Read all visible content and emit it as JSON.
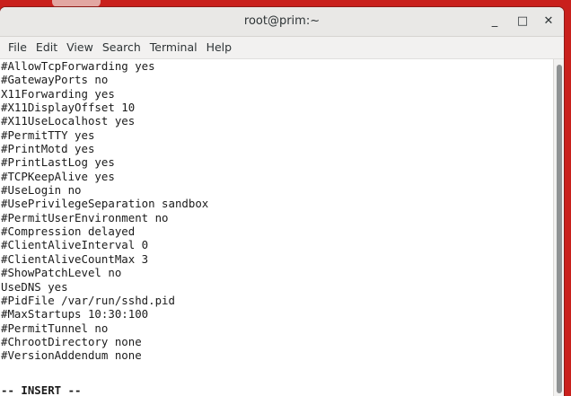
{
  "window": {
    "title": "root@prim:~",
    "minimize_glyph": "_",
    "maximize_glyph": "□",
    "close_glyph": "✕"
  },
  "menu": [
    "File",
    "Edit",
    "View",
    "Search",
    "Terminal",
    "Help"
  ],
  "terminal": {
    "lines": [
      "#AllowTcpForwarding yes",
      "#GatewayPorts no",
      "X11Forwarding yes",
      "#X11DisplayOffset 10",
      "#X11UseLocalhost yes",
      "#PermitTTY yes",
      "#PrintMotd yes",
      "#PrintLastLog yes",
      "#TCPKeepAlive yes",
      "#UseLogin no",
      "#UsePrivilegeSeparation sandbox",
      "#PermitUserEnvironment no",
      "#Compression delayed",
      "#ClientAliveInterval 0",
      "#ClientAliveCountMax 3",
      "#ShowPatchLevel no",
      "UseDNS yes",
      "#PidFile /var/run/sshd.pid",
      "#MaxStartups 10:30:100",
      "#PermitTunnel no",
      "#ChrootDirectory none",
      "#VersionAddendum none"
    ],
    "status": "-- INSERT --"
  },
  "colors": {
    "desktop": "#c9201c",
    "terminal_bg": "#ffffff",
    "terminal_fg": "#1b1b1b",
    "titlebar": "#e9e8e6"
  }
}
